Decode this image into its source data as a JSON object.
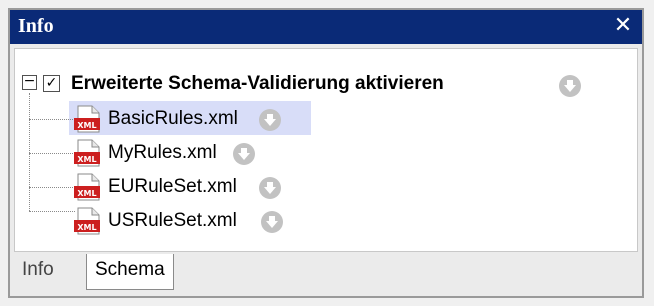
{
  "window": {
    "title": "Info",
    "close_symbol": "✕"
  },
  "main_item": {
    "expander_symbol": "−",
    "checkbox_checked": true,
    "checkbox_symbol": "✓",
    "label": "Erweiterte Schema-Validierung aktivieren",
    "action_icon": "down-arrow-circle-icon"
  },
  "files": [
    {
      "name": "BasicRules.xml",
      "selected": true,
      "icon": "xml-file-icon"
    },
    {
      "name": "MyRules.xml",
      "selected": false,
      "icon": "xml-file-icon"
    },
    {
      "name": "EURuleSet.xml",
      "selected": false,
      "icon": "xml-file-icon"
    },
    {
      "name": "USRuleSet.xml",
      "selected": false,
      "icon": "xml-file-icon"
    }
  ],
  "tabs": [
    {
      "label": "Info",
      "active": false
    },
    {
      "label": "Schema",
      "active": true
    }
  ],
  "colors": {
    "titlebar": "#0a2a77",
    "selection": "#d8ddf8",
    "file_icon_red": "#cc1f1f",
    "action_icon": "#c2c2c2"
  }
}
